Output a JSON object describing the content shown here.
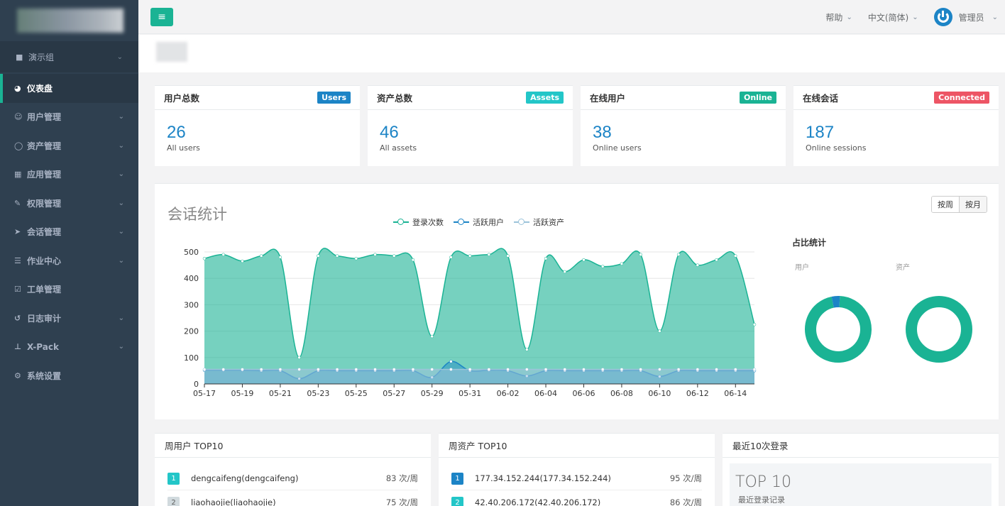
{
  "sidebar": {
    "group": {
      "icon": "bookmark-icon",
      "label": "演示组"
    },
    "items": [
      {
        "icon": "dashboard-icon",
        "label": "仪表盘",
        "active": true,
        "chevron": false
      },
      {
        "icon": "users-icon",
        "label": "用户管理",
        "chevron": true
      },
      {
        "icon": "inbox-icon",
        "label": "资产管理",
        "chevron": true
      },
      {
        "icon": "grid-icon",
        "label": "应用管理",
        "chevron": true
      },
      {
        "icon": "edit-icon",
        "label": "权限管理",
        "chevron": true
      },
      {
        "icon": "rocket-icon",
        "label": "会话管理",
        "chevron": true
      },
      {
        "icon": "server-icon",
        "label": "作业中心",
        "chevron": true
      },
      {
        "icon": "check-square-icon",
        "label": "工单管理",
        "chevron": false
      },
      {
        "icon": "history-icon",
        "label": "日志审计",
        "chevron": true
      },
      {
        "icon": "sitemap-icon",
        "label": "X-Pack",
        "chevron": true
      },
      {
        "icon": "gears-icon",
        "label": "系统设置",
        "chevron": false
      }
    ]
  },
  "topbar": {
    "help": "帮助",
    "language": "中文(简体)",
    "user": "管理员"
  },
  "stats": [
    {
      "title": "用户总数",
      "badge": "Users",
      "badge_color": "#1c84c6",
      "value": "26",
      "sub": "All users"
    },
    {
      "title": "资产总数",
      "badge": "Assets",
      "badge_color": "#23c6c8",
      "value": "46",
      "sub": "All assets"
    },
    {
      "title": "在线用户",
      "badge": "Online",
      "badge_color": "#1ab394",
      "value": "38",
      "sub": "Online users"
    },
    {
      "title": "在线会话",
      "badge": "Connected",
      "badge_color": "#ed5565",
      "value": "187",
      "sub": "Online sessions"
    }
  ],
  "session_chart": {
    "title": "会话统计",
    "toggle": [
      "按周",
      "按月"
    ],
    "legend": [
      {
        "label": "登录次数",
        "color": "#1ab394"
      },
      {
        "label": "活跃用户",
        "color": "#1c84c6"
      },
      {
        "label": "活跃资产",
        "color": "#9cc3da"
      }
    ]
  },
  "ratio": {
    "title": "占比统计",
    "user_label": "用户",
    "asset_label": "资产"
  },
  "chart_data": {
    "type": "area",
    "x": [
      "05-17",
      "05-18",
      "05-19",
      "05-20",
      "05-21",
      "05-22",
      "05-23",
      "05-24",
      "05-25",
      "05-26",
      "05-27",
      "05-28",
      "05-29",
      "05-30",
      "05-31",
      "06-01",
      "06-02",
      "06-03",
      "06-04",
      "06-05",
      "06-06",
      "06-07",
      "06-08",
      "06-09",
      "06-10",
      "06-11",
      "06-12",
      "06-13",
      "06-14",
      "06-15"
    ],
    "x_tick_labels": [
      "05-17",
      "05-19",
      "05-21",
      "05-23",
      "05-25",
      "05-27",
      "05-29",
      "05-31",
      "06-02",
      "06-04",
      "06-06",
      "06-08",
      "06-10",
      "06-12",
      "06-14"
    ],
    "series": [
      {
        "name": "登录次数",
        "values": [
          475,
          490,
          465,
          485,
          480,
          100,
          485,
          485,
          475,
          490,
          485,
          470,
          180,
          480,
          485,
          490,
          485,
          130,
          475,
          425,
          470,
          445,
          455,
          490,
          200,
          490,
          450,
          470,
          485,
          225
        ]
      },
      {
        "name": "活跃用户",
        "values": [
          52,
          52,
          52,
          50,
          50,
          20,
          50,
          50,
          50,
          50,
          50,
          50,
          25,
          85,
          50,
          52,
          50,
          30,
          50,
          50,
          50,
          50,
          50,
          50,
          28,
          50,
          50,
          50,
          50,
          50
        ]
      },
      {
        "name": "活跃资产",
        "values": [
          55,
          55,
          55,
          55,
          55,
          55,
          55,
          55,
          55,
          55,
          55,
          55,
          55,
          55,
          55,
          55,
          55,
          55,
          55,
          55,
          55,
          55,
          55,
          55,
          55,
          55,
          55,
          55,
          55,
          55
        ]
      }
    ],
    "ylim": [
      0,
      500
    ],
    "y_ticks": [
      0,
      100,
      200,
      300,
      400,
      500
    ],
    "grid": true,
    "legend_position": "top-center",
    "donuts": [
      {
        "label": "用户",
        "slices": [
          {
            "value": 0.96,
            "color": "#1ab394"
          },
          {
            "value": 0.04,
            "color": "#1c84c6"
          }
        ]
      },
      {
        "label": "资产",
        "slices": [
          {
            "value": 1.0,
            "color": "#1ab394"
          }
        ]
      }
    ]
  },
  "week_users": {
    "title": "周用户 TOP10",
    "rows": [
      {
        "rank": "1",
        "name": "dengcaifeng(dengcaifeng)",
        "count": "83 次/周",
        "color": "#23c6c8"
      },
      {
        "rank": "2",
        "name": "liaohaojie(liaohaojie)",
        "count": "75 次/周",
        "color": "#d1dade"
      }
    ]
  },
  "week_assets": {
    "title": "周资产 TOP10",
    "rows": [
      {
        "rank": "1",
        "name": "177.34.152.244(177.34.152.244)",
        "count": "95 次/周",
        "color": "#1c84c6"
      },
      {
        "rank": "2",
        "name": "42.40.206.172(42.40.206.172)",
        "count": "86 次/周",
        "color": "#23c6c8"
      }
    ]
  },
  "recent_logins": {
    "title": "最近10次登录",
    "big": "TOP 10",
    "small": "最近登录记录"
  }
}
